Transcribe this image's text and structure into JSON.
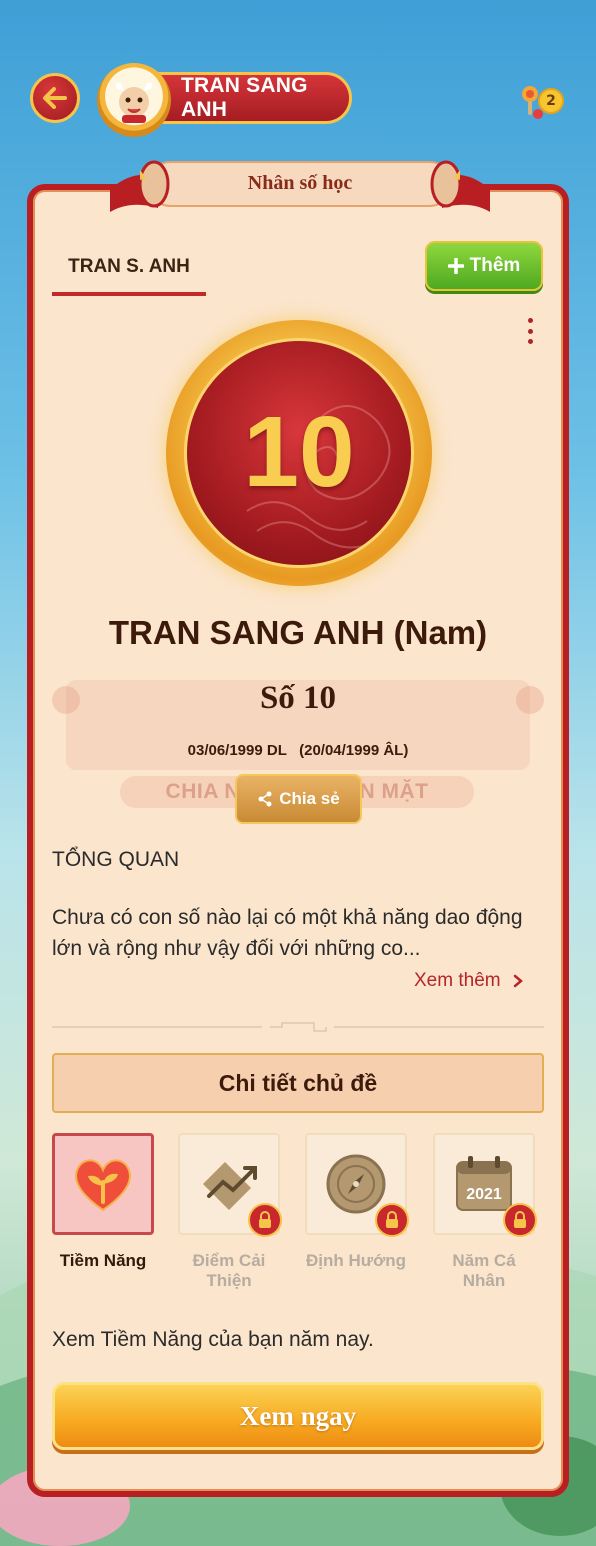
{
  "header": {
    "user_name": "TRAN SANG ANH",
    "coin_count": "2"
  },
  "card": {
    "title": "Nhân số học",
    "tab_label": "TRAN S. ANH",
    "add_label": "Thêm",
    "life_number": "10",
    "full_name": "TRAN SANG ANH (Nam)",
    "number_title": "Số 10",
    "dates": "03/06/1999 DL   (20/04/1999 ÂL)",
    "watermark": "CHIA NGAY TỶ TIỀN MẶT",
    "share_label": "Chia sẻ",
    "overview_title": "TỔNG QUAN",
    "overview_text": "Chưa có con số nào lại có một khả năng dao động lớn và rộng như vậy đối với những co...",
    "see_more": "Xem thêm",
    "topic_header": "Chi tiết chủ đề",
    "topics": [
      {
        "label": "Tiềm Năng",
        "locked": false
      },
      {
        "label": "Điểm Cải Thiện",
        "locked": true
      },
      {
        "label": "Định Hướng",
        "locked": true
      },
      {
        "label": "Năm Cá Nhân",
        "locked": true,
        "year": "2021"
      }
    ],
    "cta_text": "Xem Tiềm Năng của bạn năm nay.",
    "cta_button": "Xem ngay"
  },
  "colors": {
    "accent_red": "#b91e22",
    "card_bg": "#fbe5cd",
    "gold": "#f6c44b",
    "green": "#4ea820"
  }
}
